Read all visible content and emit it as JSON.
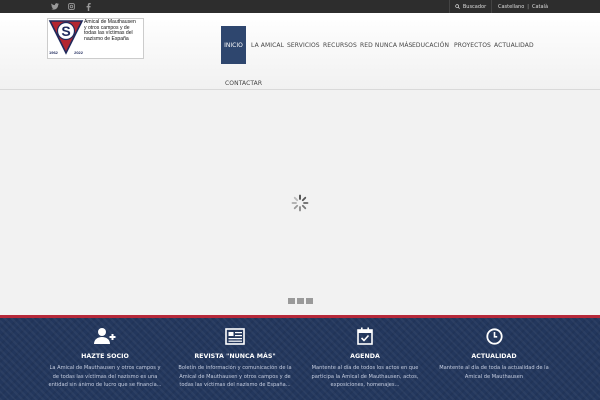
{
  "topbar": {
    "social": [
      {
        "name": "twitter-icon"
      },
      {
        "name": "instagram-icon"
      },
      {
        "name": "facebook-icon"
      }
    ],
    "search_label": "Buscador",
    "languages": [
      "Castellano",
      "Català"
    ]
  },
  "logo": {
    "lines": [
      "Amical de Mauthausen",
      "y otros campos y de",
      "todas las víctimas del",
      "nazismo de España"
    ],
    "year_start": "1962",
    "year_end": "2022",
    "letter": "S"
  },
  "nav": {
    "items": [
      "INICIO",
      "LA AMICAL",
      "SERVICIOS",
      "RECURSOS",
      "RED NUNCA MÁS",
      "EDUCACIÓN",
      "PROYECTOS",
      "ACTUALIDAD",
      "CONTACTAR"
    ],
    "active": "INICIO"
  },
  "features": [
    {
      "icon": "add-user-icon",
      "title": "HAZTE SOCIO",
      "lines": [
        "La Amical de Mauthausen y otros campos y",
        "de todas las víctimas del nazismo es una",
        "entidad sin ánimo de lucro que se financia..."
      ]
    },
    {
      "icon": "newspaper-icon",
      "title": "REVISTA \"NUNCA MÁS\"",
      "lines": [
        "Boletín de información y comunicación de la",
        "Amical de Mauthausen y otros campos y de",
        "todas las víctimas del nazismo de España..."
      ]
    },
    {
      "icon": "calendar-check-icon",
      "title": "AGENDA",
      "lines": [
        "Mantente al día de todos los actos en que",
        "participa la Amical de Mauthausen, actos,",
        "exposiciones, homenajes..."
      ]
    },
    {
      "icon": "clock-icon",
      "title": "ACTUALIDAD",
      "lines": [
        "Mantente al día de toda la actualidad de la",
        "Amical de Mauthausen"
      ]
    }
  ],
  "colors": {
    "topbar": "#2d2d2d",
    "nav_active": "#2e466e",
    "band": "#23375d",
    "band_border": "#b6293a"
  }
}
